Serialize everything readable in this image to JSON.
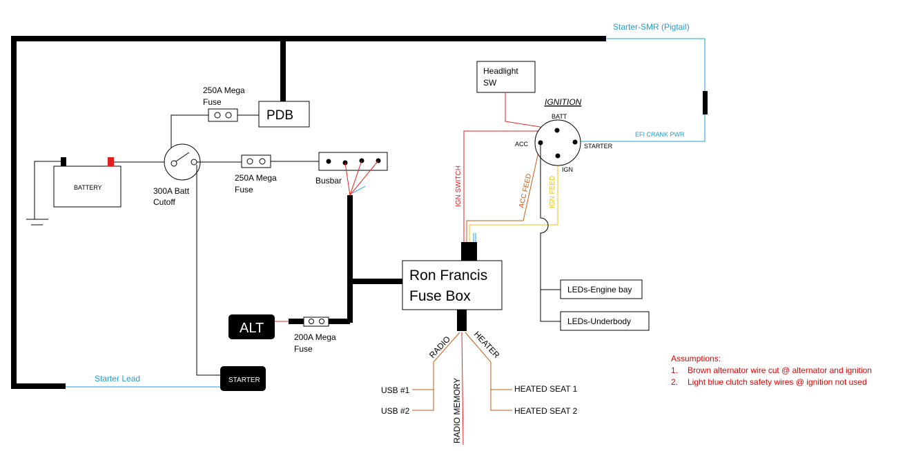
{
  "colors": {
    "red": "#e02020",
    "orange": "#c55a11",
    "yellow": "#f2c010",
    "blue": "#1aa0d8",
    "note": "#e00000"
  },
  "labels": {
    "starter_smr": "Starter-SMR (Pigtail)",
    "pdb": "PDB",
    "fuse_top_1": "250A Mega",
    "fuse_top_2": "Fuse",
    "battery": "BATTERY",
    "cutoff_1": "300A Batt",
    "cutoff_2": "Cutoff",
    "fuse_mid_1": "250A Mega",
    "fuse_mid_2": "Fuse",
    "busbar": "Busbar",
    "alt": "ALT",
    "fuse_alt_1": "200A Mega",
    "fuse_alt_2": "Fuse",
    "starter": "STARTER",
    "starter_lead": "Starter Lead",
    "fusebox_1": "Ron Francis",
    "fusebox_2": "Fuse Box",
    "headlight_1": "Headlight",
    "headlight_2": "SW",
    "ignition": "IGNITION",
    "batt": "BATT",
    "acc": "ACC",
    "starter_term": "STARTER",
    "ign": "IGN",
    "efi_crank": "EFI CRANK PWR",
    "ign_switch": "IGN SWITCH",
    "acc_feed": "ACC FEED",
    "ign_feed": "IGN FEED",
    "leds_engine": "LEDs-Engine bay",
    "leds_underbody": "LEDs-Underbody",
    "radio": "RADIO",
    "heater": "HEATER",
    "radio_memory": "RADIO MEMORY",
    "usb1": "USB #1",
    "usb2": "USB #2",
    "seat1": "HEATED SEAT 1",
    "seat2": "HEATED SEAT 2"
  },
  "assumptions": {
    "title": "Assumptions:",
    "items": [
      {
        "num": "1.",
        "text": "Brown alternator wire cut @ alternator and ignition"
      },
      {
        "num": "2.",
        "text": "Light blue clutch safety wires @ ignition not used"
      }
    ]
  }
}
